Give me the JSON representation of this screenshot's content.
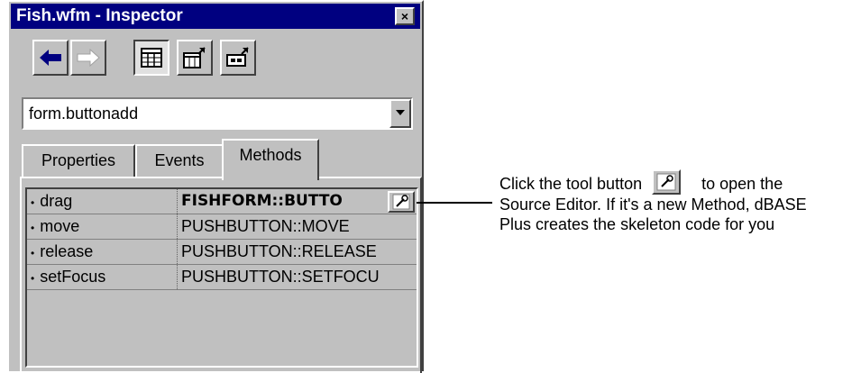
{
  "window": {
    "title": "Fish.wfm - Inspector",
    "close_label": "×"
  },
  "toolbar": {
    "buttons": [
      {
        "name": "back-arrow",
        "icon": "back-arrow-icon"
      },
      {
        "name": "forward-arrow",
        "icon": "forward-arrow-icon"
      },
      {
        "name": "grid-view",
        "icon": "grid-view-icon"
      },
      {
        "name": "object-view",
        "icon": "object-view-icon"
      },
      {
        "name": "property-view",
        "icon": "property-view-icon"
      }
    ]
  },
  "object_selector": {
    "value": "form.buttonadd"
  },
  "tabs": [
    "Properties",
    "Events",
    "Methods"
  ],
  "active_tab": "Methods",
  "methods": [
    {
      "name": "drag",
      "value": "FISHFORM::BUTTO"
    },
    {
      "name": "move",
      "value": "PUSHBUTTON::MOVE"
    },
    {
      "name": "release",
      "value": "PUSHBUTTON::RELEASE"
    },
    {
      "name": "setFocus",
      "value": "PUSHBUTTON::SETFOCU"
    }
  ],
  "callout": {
    "part1": "Click the tool button",
    "part2": "to open the",
    "line2": "Source Editor. If it's a new Method, dBASE",
    "line3": "Plus creates the skeleton code for you"
  },
  "colors": {
    "titlebar": "#000080",
    "face": "#c0c0c0",
    "back_arrow": "#000080"
  }
}
